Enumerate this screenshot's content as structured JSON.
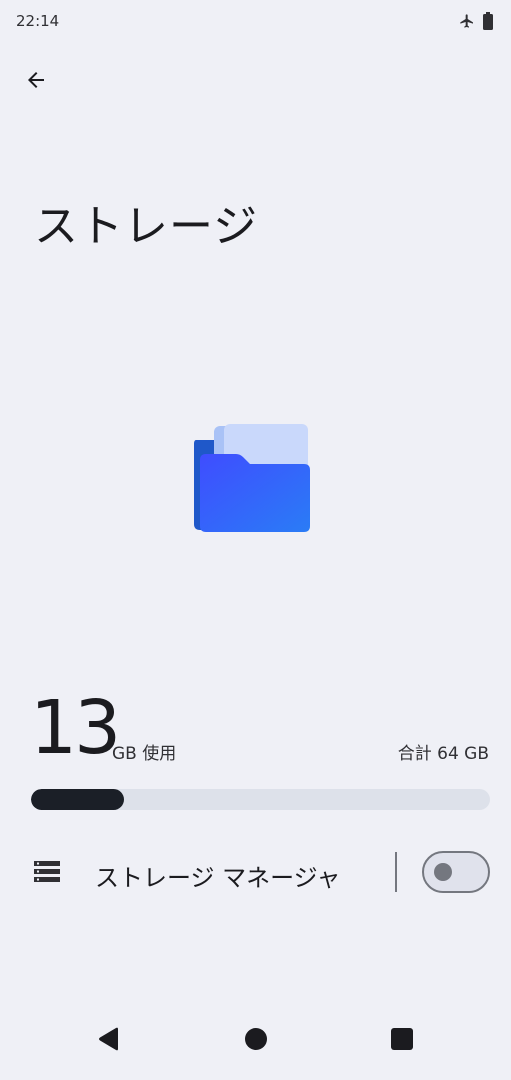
{
  "status_bar": {
    "time": "22:14",
    "icons": [
      "airplane-icon",
      "battery-icon"
    ]
  },
  "header": {
    "back_icon": "arrow-back-icon",
    "title": "ストレージ"
  },
  "illustration": {
    "icon": "folder-icon",
    "colors": {
      "back_sheet": "#1f58c9",
      "paper_light": "#c9d8fb",
      "paper_mid": "#a9c2f6",
      "folder_front_start": "#3f4dff",
      "folder_front_end": "#2a7cf6"
    }
  },
  "usage": {
    "used_value": "13",
    "used_unit": "GB 使用",
    "total_label": "合計 64 GB",
    "used_fraction": 0.203
  },
  "storage_manager": {
    "icon": "storage-list-icon",
    "label": "ストレージ マネージャ",
    "enabled": false
  },
  "navigation": {
    "icons": [
      "nav-back-icon",
      "nav-home-icon",
      "nav-recents-icon"
    ]
  },
  "colors": {
    "background": "#eff0f6",
    "text_primary": "#1b1b1f",
    "progress_fill": "#1b1f27",
    "progress_track": "#dde1ea",
    "outline": "#74777f"
  }
}
